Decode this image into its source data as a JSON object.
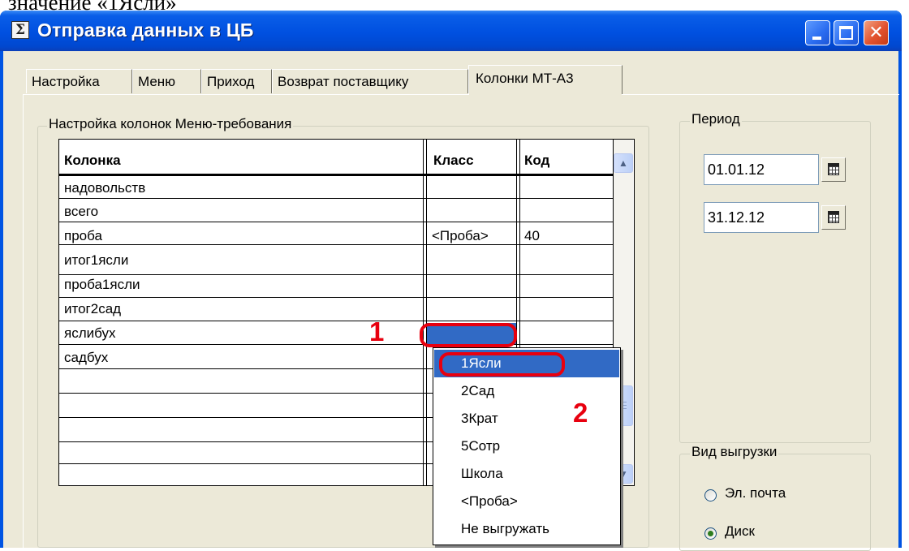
{
  "doc_text": "значение «1Ясли»",
  "window": {
    "title": "Отправка данных в ЦБ",
    "app_icon_glyph": "Σ",
    "close_glyph": "✕"
  },
  "tabs": [
    {
      "label": "Настройка",
      "active": false
    },
    {
      "label": "Меню",
      "active": false
    },
    {
      "label": "Приход",
      "active": false
    },
    {
      "label": "Возврат поставщику",
      "active": false
    },
    {
      "label": "Колонки МТ-А3",
      "active": true
    }
  ],
  "columns_group": {
    "label": "Настройка колонок Меню-требования",
    "headers": [
      "Колонка",
      "Класс",
      "Код"
    ],
    "rows": [
      {
        "column": "надовольств",
        "class": "",
        "code": ""
      },
      {
        "column": "всего",
        "class": "",
        "code": ""
      },
      {
        "column": "проба",
        "class": "<Проба>",
        "code": "40"
      },
      {
        "column": "итог1ясли",
        "class": "",
        "code": ""
      },
      {
        "column": "проба1ясли",
        "class": "",
        "code": ""
      },
      {
        "column": "итог2сад",
        "class": "",
        "code": ""
      },
      {
        "column": "яслибух",
        "class": "",
        "code": ""
      },
      {
        "column": "садбух",
        "class": "",
        "code": ""
      }
    ],
    "scroll_up": "▲",
    "scroll_down": "▼"
  },
  "class_dropdown": {
    "options": [
      "1Ясли",
      "2Сад",
      "3Крат",
      "5Сотр",
      "Школа",
      "<Проба>",
      "Не выгружать"
    ],
    "selected": "1Ясли"
  },
  "annotations": {
    "step1": "1",
    "step2": "2",
    "accent": "#e8000f"
  },
  "period": {
    "label": "Период",
    "from": "01.01.12",
    "to": "31.12.12"
  },
  "export_type": {
    "label": "Вид выгрузки",
    "options": [
      {
        "label": "Эл. почта",
        "checked": false
      },
      {
        "label": "Диск",
        "checked": true
      }
    ]
  },
  "colors": {
    "titlebar": "#0054e3",
    "selection": "#316ac5",
    "face": "#ece9d8"
  }
}
